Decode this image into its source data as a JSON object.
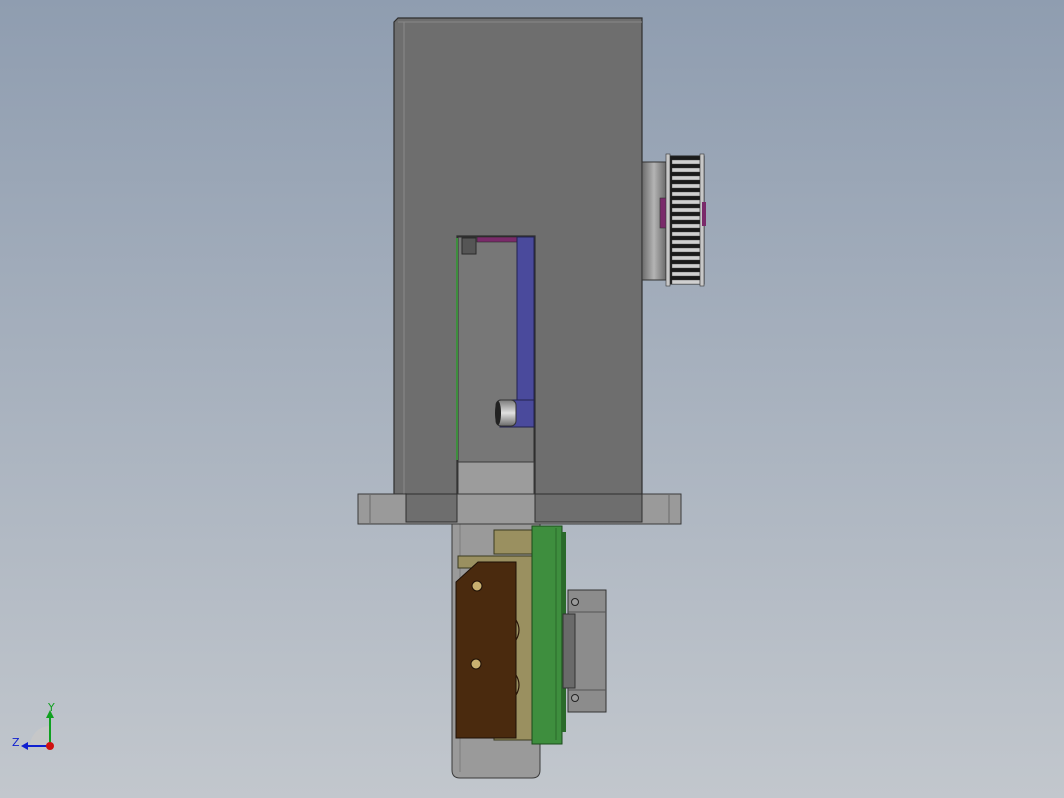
{
  "viewport": {
    "background_top": "#8f9db0",
    "background_bottom": "#c2c7cd"
  },
  "triad": {
    "x_color": "#d01010",
    "y_color": "#10a020",
    "z_color": "#1020d0",
    "y_label": "Y",
    "z_label": "Z"
  },
  "colors": {
    "housing": "#6e6e6e",
    "housing_edge": "#3a3a3a",
    "plate": "#9a9a9a",
    "lever": "#4a4a9c",
    "switch_body": "#4a2a0e",
    "pcb": "#3e8e3e",
    "bracket": "#9a9060",
    "pulley": "#8a8a8a",
    "accent": "#7a2a6a"
  }
}
